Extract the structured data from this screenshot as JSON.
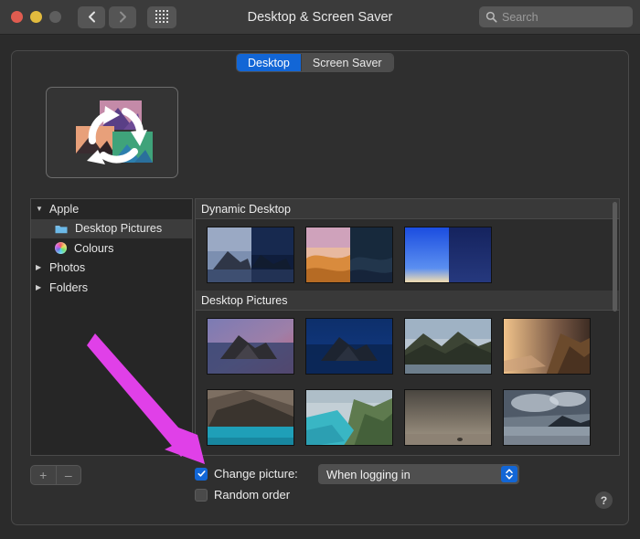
{
  "window": {
    "title": "Desktop & Screen Saver",
    "traffic_lights": [
      "close",
      "minimize",
      "zoom"
    ],
    "nav": {
      "back_icon": "chevron-left-icon",
      "forward_icon": "chevron-right-icon",
      "grid_icon": "grid-apps-icon"
    }
  },
  "search": {
    "placeholder": "Search",
    "icon": "search-icon",
    "value": ""
  },
  "tabs": [
    {
      "label": "Desktop",
      "active": true
    },
    {
      "label": "Screen Saver",
      "active": false
    }
  ],
  "preview": {
    "icon": "rotating-pictures-icon"
  },
  "sidebar": {
    "items": [
      {
        "label": "Apple",
        "disclosure": "▼",
        "level": 0,
        "icon": "",
        "selected": false
      },
      {
        "label": "Desktop Pictures",
        "disclosure": "",
        "level": 1,
        "icon": "folder-icon",
        "selected": true
      },
      {
        "label": "Colours",
        "disclosure": "",
        "level": 1,
        "icon": "color-wheel-icon",
        "selected": false
      },
      {
        "label": "Photos",
        "disclosure": "▶",
        "level": 0,
        "icon": "",
        "selected": false
      },
      {
        "label": "Folders",
        "disclosure": "▶",
        "level": 0,
        "icon": "",
        "selected": false
      }
    ],
    "add_label": "+",
    "remove_label": "–"
  },
  "groups": [
    {
      "header": "Dynamic Desktop",
      "thumbnails": [
        {
          "name": "catalina-dynamic"
        },
        {
          "name": "mojave-dynamic"
        },
        {
          "name": "solar-gradients-dynamic"
        }
      ]
    },
    {
      "header": "Desktop Pictures",
      "thumbnails": [
        {
          "name": "catalina-day"
        },
        {
          "name": "catalina-night"
        },
        {
          "name": "catalina-rock-day"
        },
        {
          "name": "catalina-shore-sunset"
        },
        {
          "name": "catalina-cliffs"
        },
        {
          "name": "catalina-coast"
        },
        {
          "name": "catalina-beach-fog"
        },
        {
          "name": "catalina-clouds"
        }
      ]
    }
  ],
  "controls": {
    "change_picture": {
      "label": "Change picture:",
      "checked": true
    },
    "random_order": {
      "label": "Random order",
      "checked": false
    },
    "interval": {
      "value": "When logging in",
      "stepper_icon": "stepper-up-down-icon"
    },
    "help": {
      "label": "?"
    }
  },
  "annotation": {
    "arrow_color": "#e040e8",
    "points_to": "change-picture-checkbox"
  },
  "colors": {
    "accent_blue": "#1266d6",
    "window_bg": "#2b2b2b",
    "titlebar_bg": "#3b3b3b",
    "panel_bg": "#2f2f2f",
    "sidebar_bg": "#262626",
    "group_header_bg": "#393939",
    "arrow_magenta": "#e040e8"
  }
}
